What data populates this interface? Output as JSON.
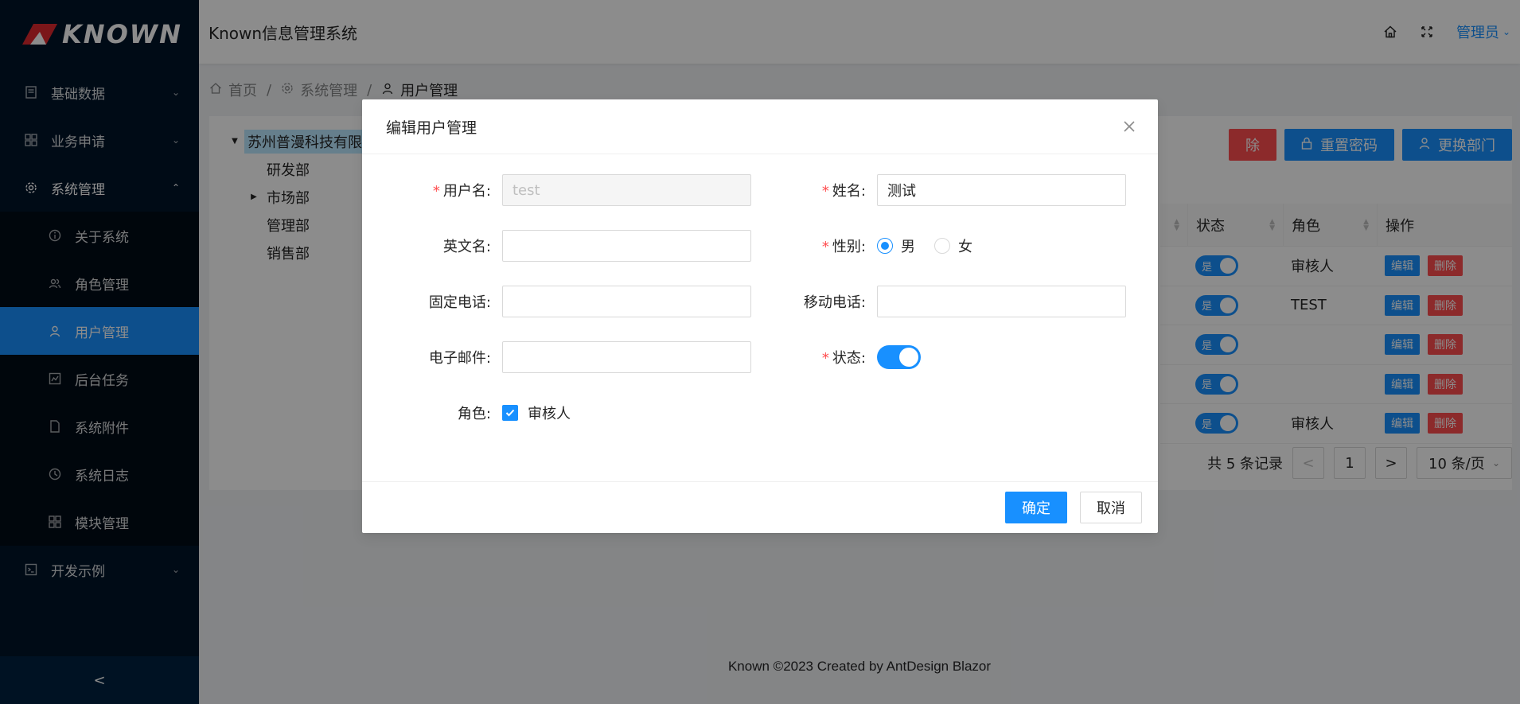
{
  "app": {
    "logo_text": "KNOWN",
    "title": "Known信息管理系统",
    "user": "管理员"
  },
  "sidebar": {
    "items": [
      {
        "label": "基础数据",
        "icon": "table-icon"
      },
      {
        "label": "业务申请",
        "icon": "appstore-icon"
      },
      {
        "label": "系统管理",
        "icon": "setting-icon"
      },
      {
        "label": "开发示例",
        "icon": "code-icon"
      }
    ],
    "sub_items": [
      {
        "label": "关于系统",
        "icon": "info-icon"
      },
      {
        "label": "角色管理",
        "icon": "team-icon"
      },
      {
        "label": "用户管理",
        "icon": "user-icon"
      },
      {
        "label": "后台任务",
        "icon": "fund-icon"
      },
      {
        "label": "系统附件",
        "icon": "file-icon"
      },
      {
        "label": "系统日志",
        "icon": "clock-icon"
      },
      {
        "label": "模块管理",
        "icon": "appstore-icon"
      }
    ],
    "collapse": "<"
  },
  "breadcrumb": {
    "home": "首页",
    "section": "系统管理",
    "page": "用户管理",
    "sep": "/"
  },
  "tree": {
    "root": "苏州普漫科技有限公",
    "children": [
      "研发部",
      "市场部",
      "管理部",
      "销售部"
    ]
  },
  "toolbar": {
    "delete": "除",
    "reset_password": "重置密码",
    "change_dept": "更换部门"
  },
  "table": {
    "headers": {
      "status": "状态",
      "role": "角色",
      "action": "操作"
    },
    "switch_label": "是",
    "edit": "编辑",
    "delete": "删除",
    "rows": [
      {
        "role": "审核人"
      },
      {
        "role": "TEST"
      },
      {
        "role": ""
      },
      {
        "role": ""
      },
      {
        "role": "审核人"
      }
    ]
  },
  "pagination": {
    "total": "共 5 条记录",
    "prev": "<",
    "page": "1",
    "next": ">",
    "size": "10 条/页"
  },
  "footer": "Known ©2023 Created by AntDesign Blazor",
  "modal": {
    "title": "编辑用户管理",
    "close": "×",
    "fields": {
      "username": {
        "label": "用户名:",
        "value": "test",
        "required": "*"
      },
      "name": {
        "label": "姓名:",
        "value": "测试",
        "required": "*"
      },
      "english_name": {
        "label": "英文名:",
        "value": ""
      },
      "gender": {
        "label": "性别:",
        "required": "*",
        "options": [
          "男",
          "女"
        ],
        "selected": "男"
      },
      "phone": {
        "label": "固定电话:",
        "value": ""
      },
      "mobile": {
        "label": "移动电话:",
        "value": ""
      },
      "email": {
        "label": "电子邮件:",
        "value": ""
      },
      "status": {
        "label": "状态:",
        "required": "*",
        "on": true
      },
      "role": {
        "label": "角色:",
        "option": "审核人",
        "checked": true
      }
    },
    "ok": "确定",
    "cancel": "取消"
  },
  "colors": {
    "primary": "#1890ff",
    "danger": "#ff4d4f",
    "sider": "#001529"
  }
}
